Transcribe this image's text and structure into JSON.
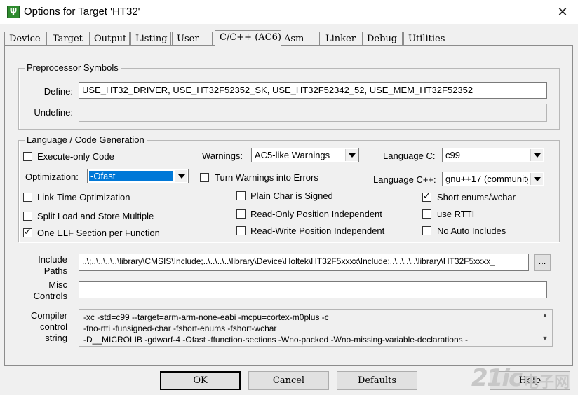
{
  "window": {
    "title": "Options for Target 'HT32'",
    "icon": "uvision-icon",
    "icon_glyph": "Ψ"
  },
  "tabs": [
    {
      "label": "Device"
    },
    {
      "label": "Target"
    },
    {
      "label": "Output"
    },
    {
      "label": "Listing"
    },
    {
      "label": "User"
    },
    {
      "label": "C/C++ (AC6)",
      "active": true
    },
    {
      "label": "Asm"
    },
    {
      "label": "Linker"
    },
    {
      "label": "Debug"
    },
    {
      "label": "Utilities"
    }
  ],
  "preprocessor": {
    "title": "Preprocessor Symbols",
    "define_label": "Define:",
    "define_value": "USE_HT32_DRIVER, USE_HT32F52352_SK, USE_HT32F52342_52, USE_MEM_HT32F52352",
    "undefine_label": "Undefine:",
    "undefine_value": ""
  },
  "language": {
    "title": "Language / Code Generation",
    "execute_only": {
      "label": "Execute-only Code",
      "checked": false
    },
    "optimization_label": "Optimization:",
    "optimization_value": "-Ofast",
    "link_time": {
      "label": "Link-Time Optimization",
      "checked": false
    },
    "split_load": {
      "label": "Split Load and Store Multiple",
      "checked": false
    },
    "one_elf": {
      "label": "One ELF Section per Function",
      "checked": true
    },
    "warnings_label": "Warnings:",
    "warnings_value": "AC5-like Warnings",
    "warnings_errors": {
      "label": "Turn Warnings into Errors",
      "checked": false
    },
    "plain_char": {
      "label": "Plain Char is Signed",
      "checked": false
    },
    "ro_pi": {
      "label": "Read-Only Position Independent",
      "checked": false
    },
    "rw_pi": {
      "label": "Read-Write Position Independent",
      "checked": false
    },
    "language_c_label": "Language C:",
    "language_c_value": "c99",
    "language_cpp_label": "Language C++:",
    "language_cpp_value": "gnu++17 (community",
    "short_enums": {
      "label": "Short enums/wchar",
      "checked": true
    },
    "use_rtti": {
      "label": "use RTTI",
      "checked": false
    },
    "no_auto": {
      "label": "No Auto Includes",
      "checked": false
    }
  },
  "include": {
    "label_line1": "Include",
    "label_line2": "Paths",
    "value": "..\\;..\\..\\..\\..\\library\\CMSIS\\Include;..\\..\\..\\..\\library\\Device\\Holtek\\HT32F5xxxx\\Include;..\\..\\..\\..\\library\\HT32F5xxxx_",
    "browse_label": "..."
  },
  "misc": {
    "label_line1": "Misc",
    "label_line2": "Controls",
    "value": ""
  },
  "compiler": {
    "label_line1": "Compiler",
    "label_line2": "control",
    "label_line3": "string",
    "lines": [
      "-xc -std=c99 --target=arm-arm-none-eabi -mcpu=cortex-m0plus -c",
      "-fno-rtti -funsigned-char -fshort-enums -fshort-wchar",
      "-D__MICROLIB -gdwarf-4 -Ofast -ffunction-sections -Wno-packed -Wno-missing-variable-declarations -"
    ]
  },
  "buttons": {
    "ok": "OK",
    "cancel": "Cancel",
    "defaults": "Defaults",
    "help": "Help"
  },
  "watermark": {
    "text": "21ic",
    "sub": "电子网"
  }
}
